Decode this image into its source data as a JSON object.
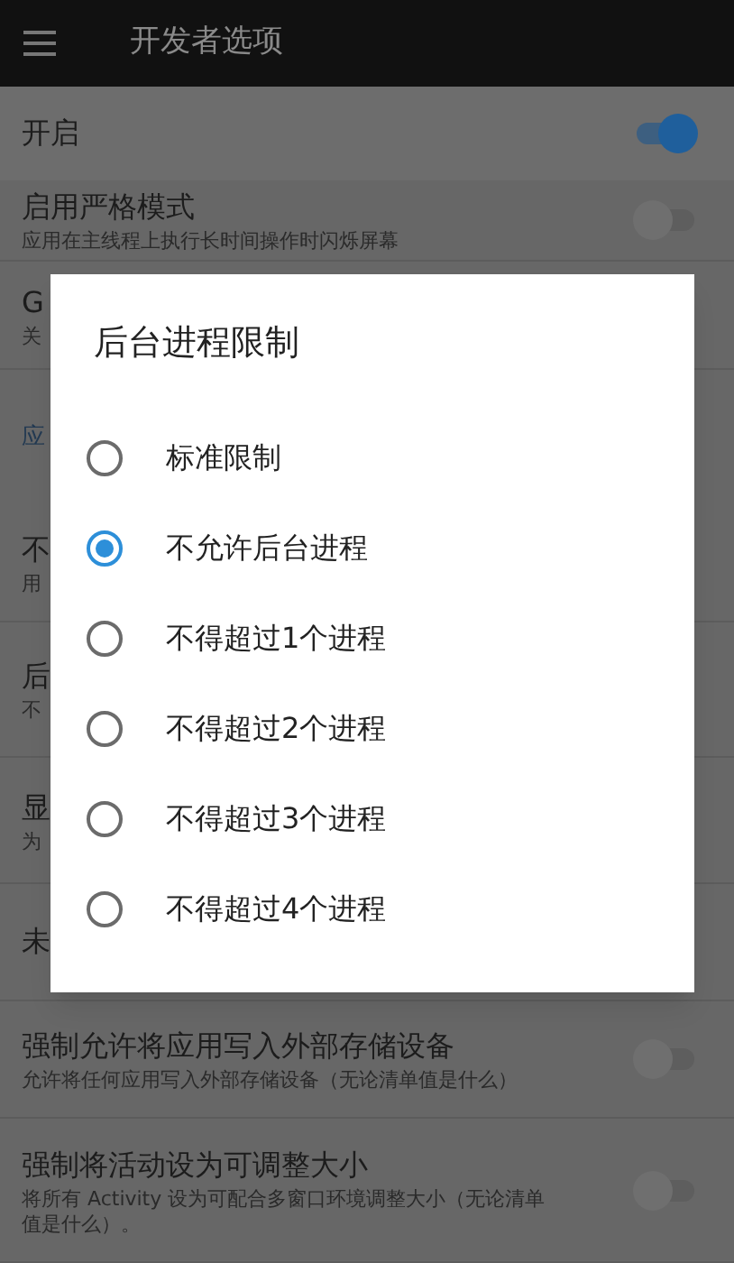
{
  "app_bar": {
    "title": "开发者选项"
  },
  "settings": [
    {
      "kind": "switch",
      "title": "开启",
      "on": true
    },
    {
      "kind": "switch",
      "title": "启用严格模式",
      "subtitle": "应用在主线程上执行长时间操作时闪烁屏幕",
      "on": false
    },
    {
      "kind": "item",
      "title": "G",
      "subtitle": "关"
    },
    {
      "kind": "header",
      "title": "应"
    },
    {
      "kind": "item",
      "title": "不",
      "subtitle": "用"
    },
    {
      "kind": "item",
      "title": "后",
      "subtitle": "不"
    },
    {
      "kind": "item",
      "title": "显",
      "subtitle": "为"
    },
    {
      "kind": "item",
      "title": "未"
    },
    {
      "kind": "switch",
      "title": "强制允许将应用写入外部存储设备",
      "subtitle": "允许将任何应用写入外部存储设备（无论清单值是什么）",
      "on": false
    },
    {
      "kind": "switch",
      "title": "强制将活动设为可调整大小",
      "subtitle": "将所有 Activity 设为可配合多窗口环境调整大小（无论清单值是什么）。",
      "on": false
    }
  ],
  "dialog": {
    "title": "后台进程限制",
    "options": [
      {
        "label": "标准限制",
        "selected": false
      },
      {
        "label": "不允许后台进程",
        "selected": true
      },
      {
        "label": "不得超过1个进程",
        "selected": false
      },
      {
        "label": "不得超过2个进程",
        "selected": false
      },
      {
        "label": "不得超过3个进程",
        "selected": false
      },
      {
        "label": "不得超过4个进程",
        "selected": false
      }
    ]
  }
}
